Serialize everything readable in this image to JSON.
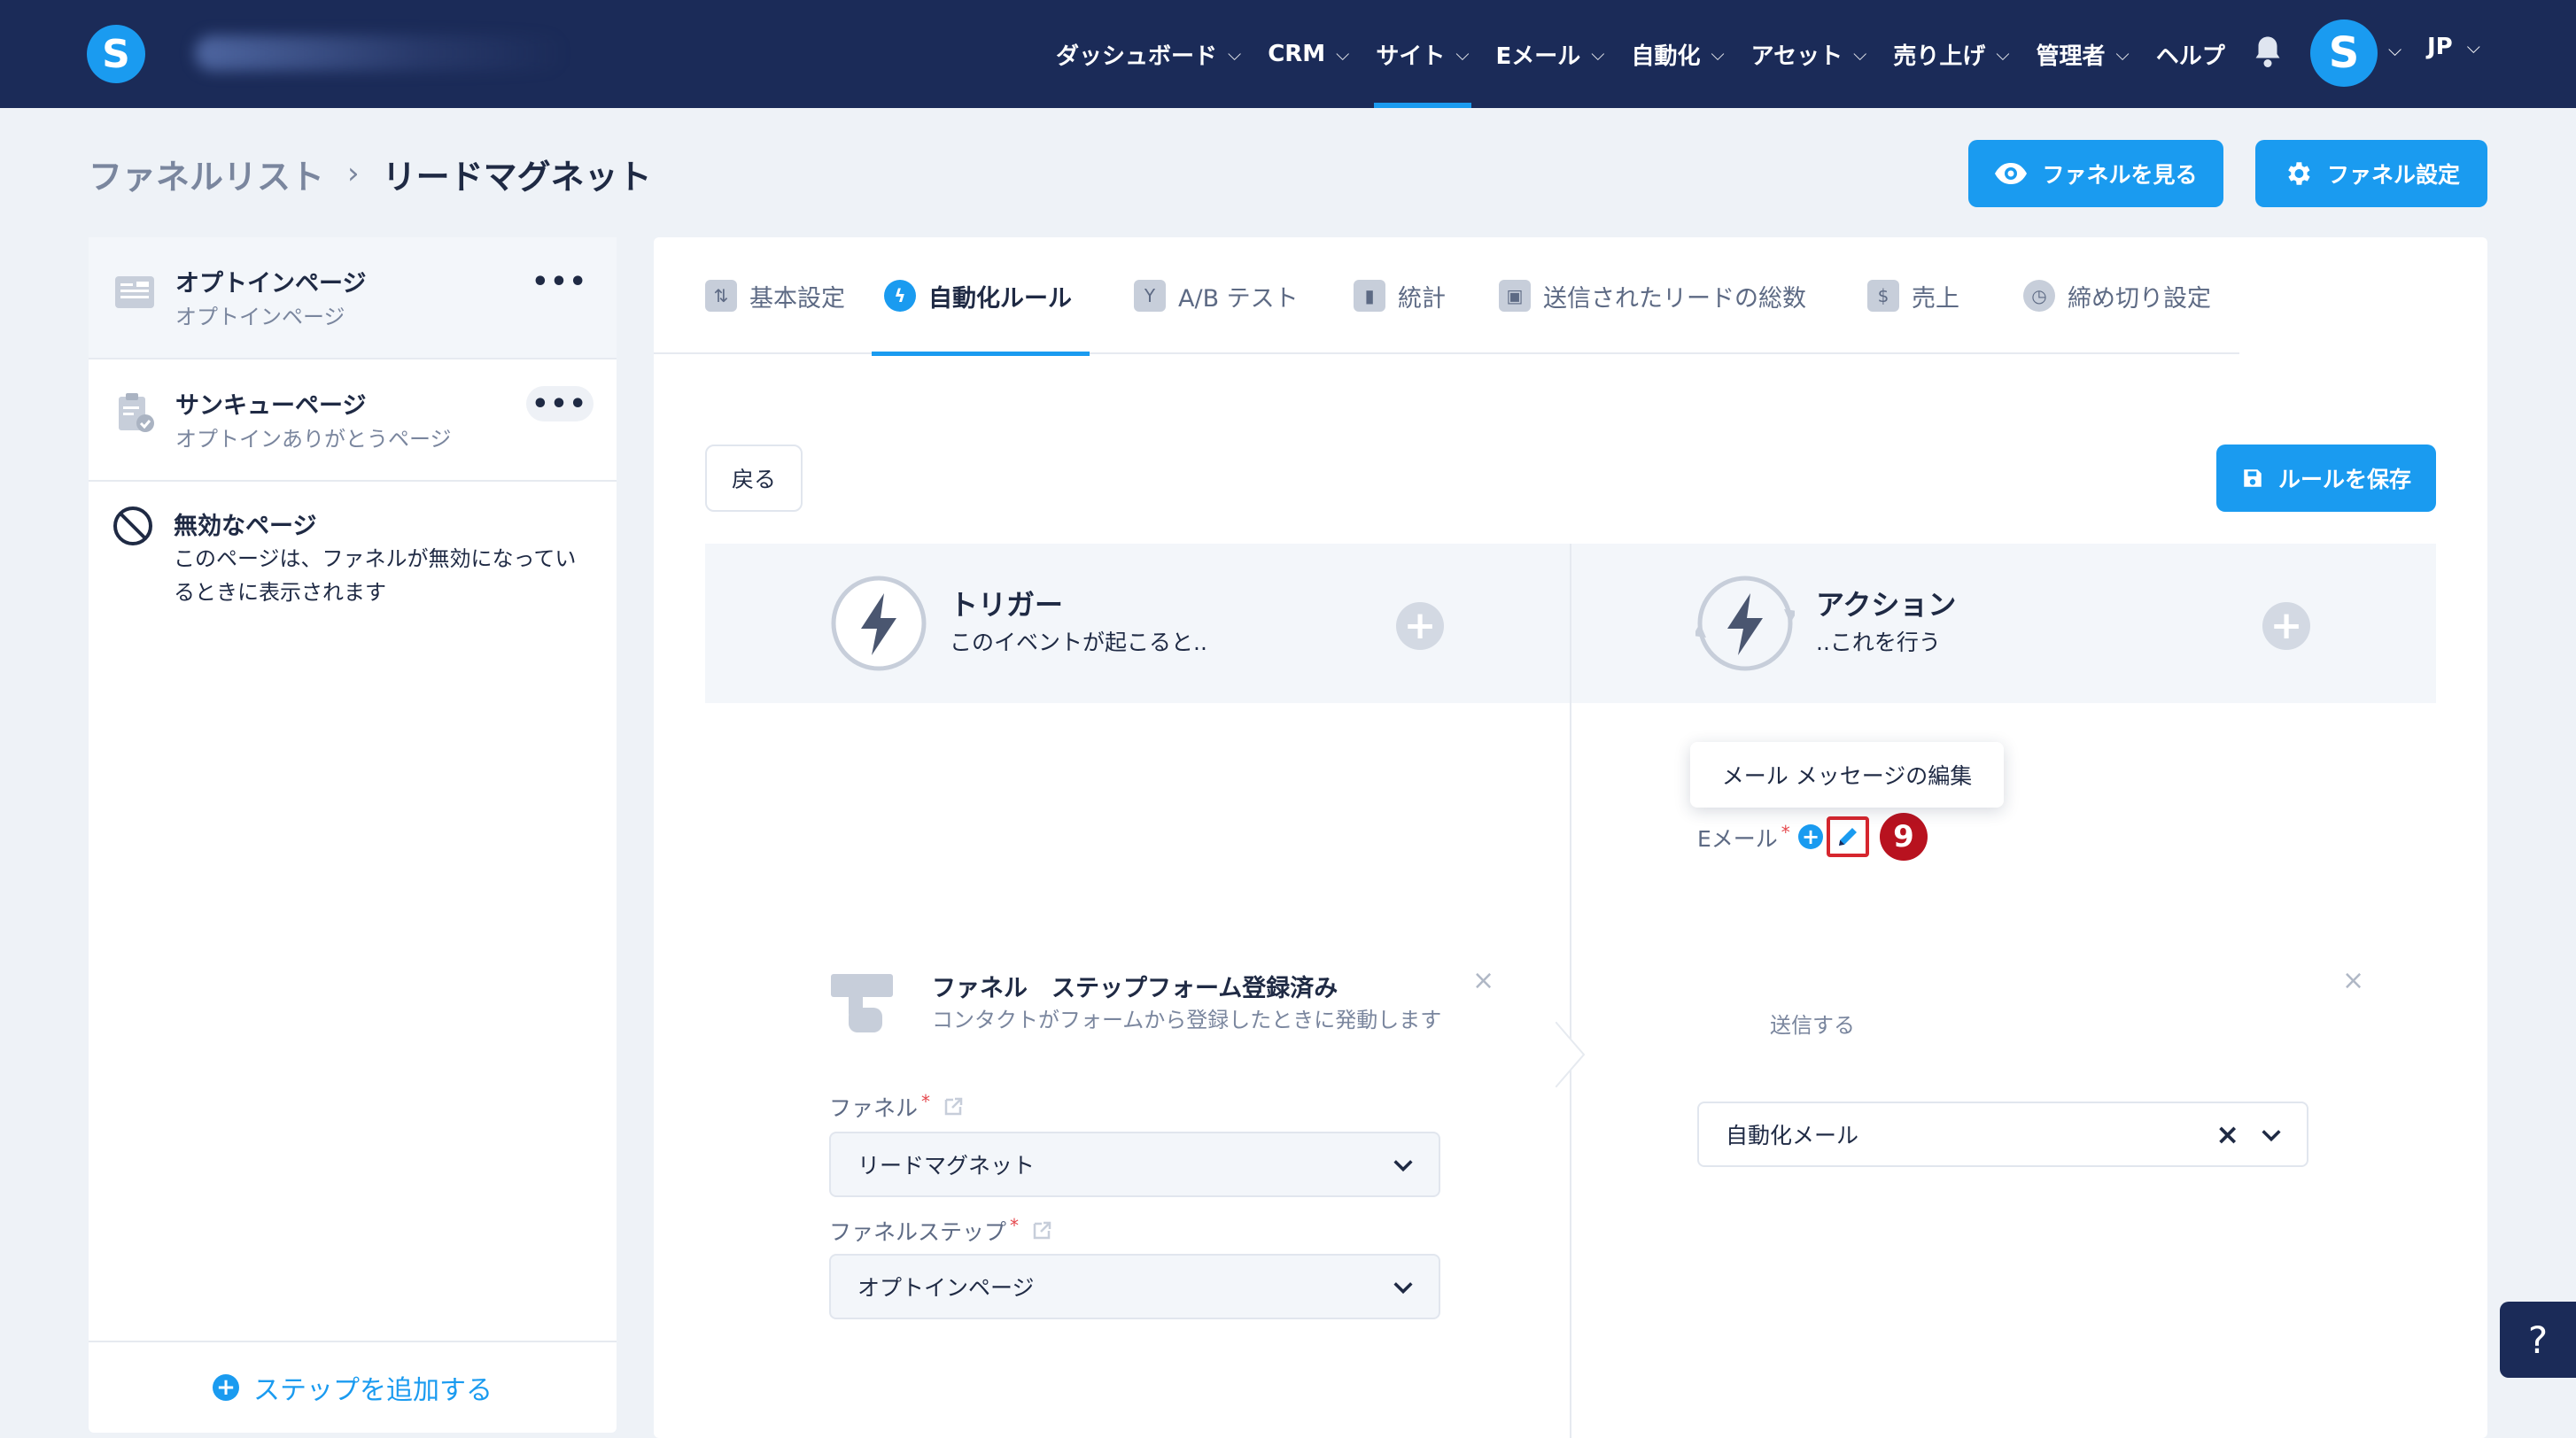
{
  "nav": {
    "logo_letter": "S",
    "items": [
      {
        "label": "ダッシュボード",
        "has_menu": true
      },
      {
        "label": "CRM",
        "has_menu": true
      },
      {
        "label": "サイト",
        "has_menu": true,
        "active": true
      },
      {
        "label": "Eメール",
        "has_menu": true
      },
      {
        "label": "自動化",
        "has_menu": true
      },
      {
        "label": "アセット",
        "has_menu": true
      },
      {
        "label": "売り上げ",
        "has_menu": true
      },
      {
        "label": "管理者",
        "has_menu": true
      },
      {
        "label": "ヘルプ",
        "has_menu": false
      }
    ],
    "avatar_letter": "S",
    "language": "JP",
    "chevron": "⌵"
  },
  "breadcrumb": {
    "parent": "ファネルリスト",
    "separator": "›",
    "current": "リードマグネット"
  },
  "header_buttons": {
    "view_funnel": "ファネルを見る",
    "funnel_settings": "ファネル設定"
  },
  "sidebar": {
    "pages": [
      {
        "title": "オプトインページ",
        "subtitle": "オプトインページ",
        "icon": "form-page-icon"
      },
      {
        "title": "サンキューページ",
        "subtitle": "オプトインありがとうページ",
        "icon": "clipboard-check-icon"
      }
    ],
    "inactive": {
      "title": "無効なページ",
      "description": "このページは、ファネルが無効になっているときに表示されます"
    },
    "menu_dots": "•••",
    "add_step": "ステップを追加する"
  },
  "tabs": [
    {
      "label": "基本設定",
      "icon": "sliders-icon"
    },
    {
      "label": "自動化ルール",
      "icon": "lightning-icon",
      "active": true
    },
    {
      "label": "A/B テスト",
      "icon": "split-icon"
    },
    {
      "label": "統計",
      "icon": "bar-chart-icon"
    },
    {
      "label": "送信されたリードの総数",
      "icon": "users-icon"
    },
    {
      "label": "売上",
      "icon": "dollar-icon"
    },
    {
      "label": "締め切り設定",
      "icon": "clock-icon"
    }
  ],
  "tab_icon_glyphs": [
    "⇅",
    "ϟ",
    "Y",
    "▮",
    "▣",
    "$",
    "◷"
  ],
  "rule": {
    "back": "戻る",
    "save": "ルールを保存",
    "trigger": {
      "title": "トリガー",
      "subtitle": "このイベントが起こると..",
      "card_title": "ファネル　ステップフォーム登録済み",
      "card_desc": "コンタクトがフォームから登録したときに発動します",
      "funnel_label": "ファネル",
      "funnel_value": "リードマグネット",
      "step_label": "ファネルステップ",
      "step_value": "オプトインページ"
    },
    "action": {
      "title": "アクション",
      "subtitle": "..これを行う",
      "card_desc_partial": "送信する",
      "email_label": "Eメール",
      "email_value": "自動化メール",
      "tooltip": "メール メッセージの編集"
    }
  },
  "step_number": "9",
  "help": "?",
  "colors": {
    "nav_bg": "#1b2b58",
    "accent": "#1a9bf0",
    "highlight": "#d6262e",
    "badge": "#b8121f"
  }
}
